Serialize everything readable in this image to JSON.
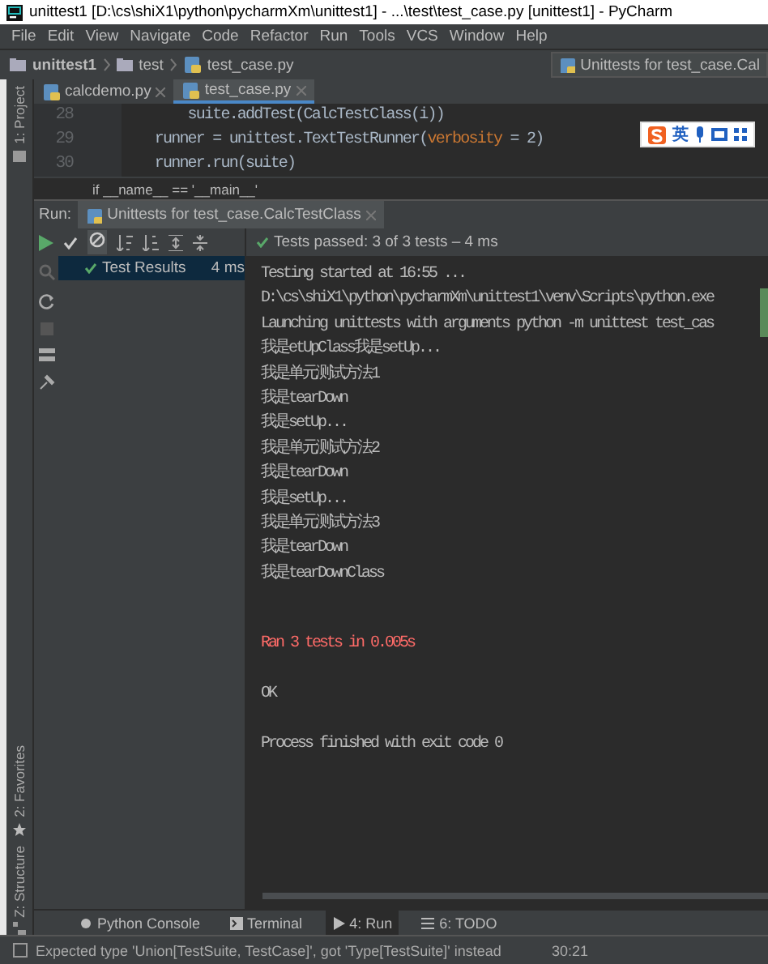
{
  "window": {
    "title": "unittest1 [D:\\cs\\shiX1\\python\\pycharmXm\\unittest1] - ...\\test\\test_case.py [unittest1] - PyCharm"
  },
  "menu": [
    "File",
    "Edit",
    "View",
    "Navigate",
    "Code",
    "Refactor",
    "Run",
    "Tools",
    "VCS",
    "Window",
    "Help"
  ],
  "breadcrumbs": [
    "unittest1",
    "test",
    "test_case.py"
  ],
  "run_config": "Unittests for test_case.Cal",
  "left_tool_bar": [
    {
      "label": "1: Project",
      "kind": "project"
    },
    {
      "label": "2: Favorites",
      "kind": "favorites"
    },
    {
      "label": "Z: Structure",
      "kind": "structure"
    }
  ],
  "editor_tabs": [
    {
      "label": "calcdemo.py",
      "selected": false
    },
    {
      "label": "test_case.py",
      "selected": true
    }
  ],
  "code_lines": [
    {
      "number": "28",
      "segments": [
        {
          "text": "        suite.addTest(CalcTestClass(i))",
          "kind": "plain"
        }
      ]
    },
    {
      "number": "29",
      "segments": [
        {
          "text": "    runner = unittest.TextTestRunner(",
          "kind": "plain"
        },
        {
          "text": "verbosity",
          "kind": "param"
        },
        {
          "text": " = 2)",
          "kind": "plain"
        }
      ]
    },
    {
      "number": "30",
      "segments": [
        {
          "text": "    runner.run(suite)",
          "kind": "plain"
        }
      ]
    }
  ],
  "code_breadcrumb": "if __name__ == '__main__'",
  "ime_toolbar": {
    "label": "英"
  },
  "run": {
    "label": "Run:",
    "tab": "Unittests for test_case.CalcTestClass",
    "status": "Tests passed: 3 of 3 tests – 4 ms",
    "tree": [
      {
        "label": "Test Results",
        "time": "4 ms",
        "selected": true
      }
    ],
    "console": [
      {
        "text": "Testing started at 16:55 ...",
        "kind": "output"
      },
      {
        "text": "D:\\cs\\shiX1\\python\\pycharmXm\\unittest1\\venv\\Scripts\\python.exe",
        "kind": "output"
      },
      {
        "text": "Launching unittests with arguments python -m unittest test_cas",
        "kind": "output"
      },
      {
        "text": "我是etUpClass我是setUp...",
        "kind": "output"
      },
      {
        "text": "我是单元测试方法1",
        "kind": "output"
      },
      {
        "text": "我是tearDown",
        "kind": "output"
      },
      {
        "text": "我是setUp...",
        "kind": "output"
      },
      {
        "text": "我是单元测试方法2",
        "kind": "output"
      },
      {
        "text": "我是tearDown",
        "kind": "output"
      },
      {
        "text": "我是setUp...",
        "kind": "output"
      },
      {
        "text": "我是单元测试方法3",
        "kind": "output"
      },
      {
        "text": "我是tearDown",
        "kind": "output"
      },
      {
        "text": "我是tearDownClass",
        "kind": "output"
      },
      {
        "text": "Ran 3 tests in 0.005s",
        "kind": "result"
      },
      {
        "text": "OK",
        "kind": "summary"
      },
      {
        "text": "Process finished with exit code 0",
        "kind": "summary"
      }
    ]
  },
  "bottom_tabs": [
    {
      "label": "Python Console",
      "selected": false,
      "kind": "console"
    },
    {
      "label": "Terminal",
      "selected": false,
      "kind": "terminal"
    },
    {
      "label": "4: Run",
      "selected": true,
      "kind": "run"
    },
    {
      "label": "6: TODO",
      "selected": false,
      "kind": "todo"
    }
  ],
  "status_bar": {
    "message": "Expected type 'Union[TestSuite, TestCase]', got 'Type[TestSuite]' instead",
    "position": "30:21"
  }
}
